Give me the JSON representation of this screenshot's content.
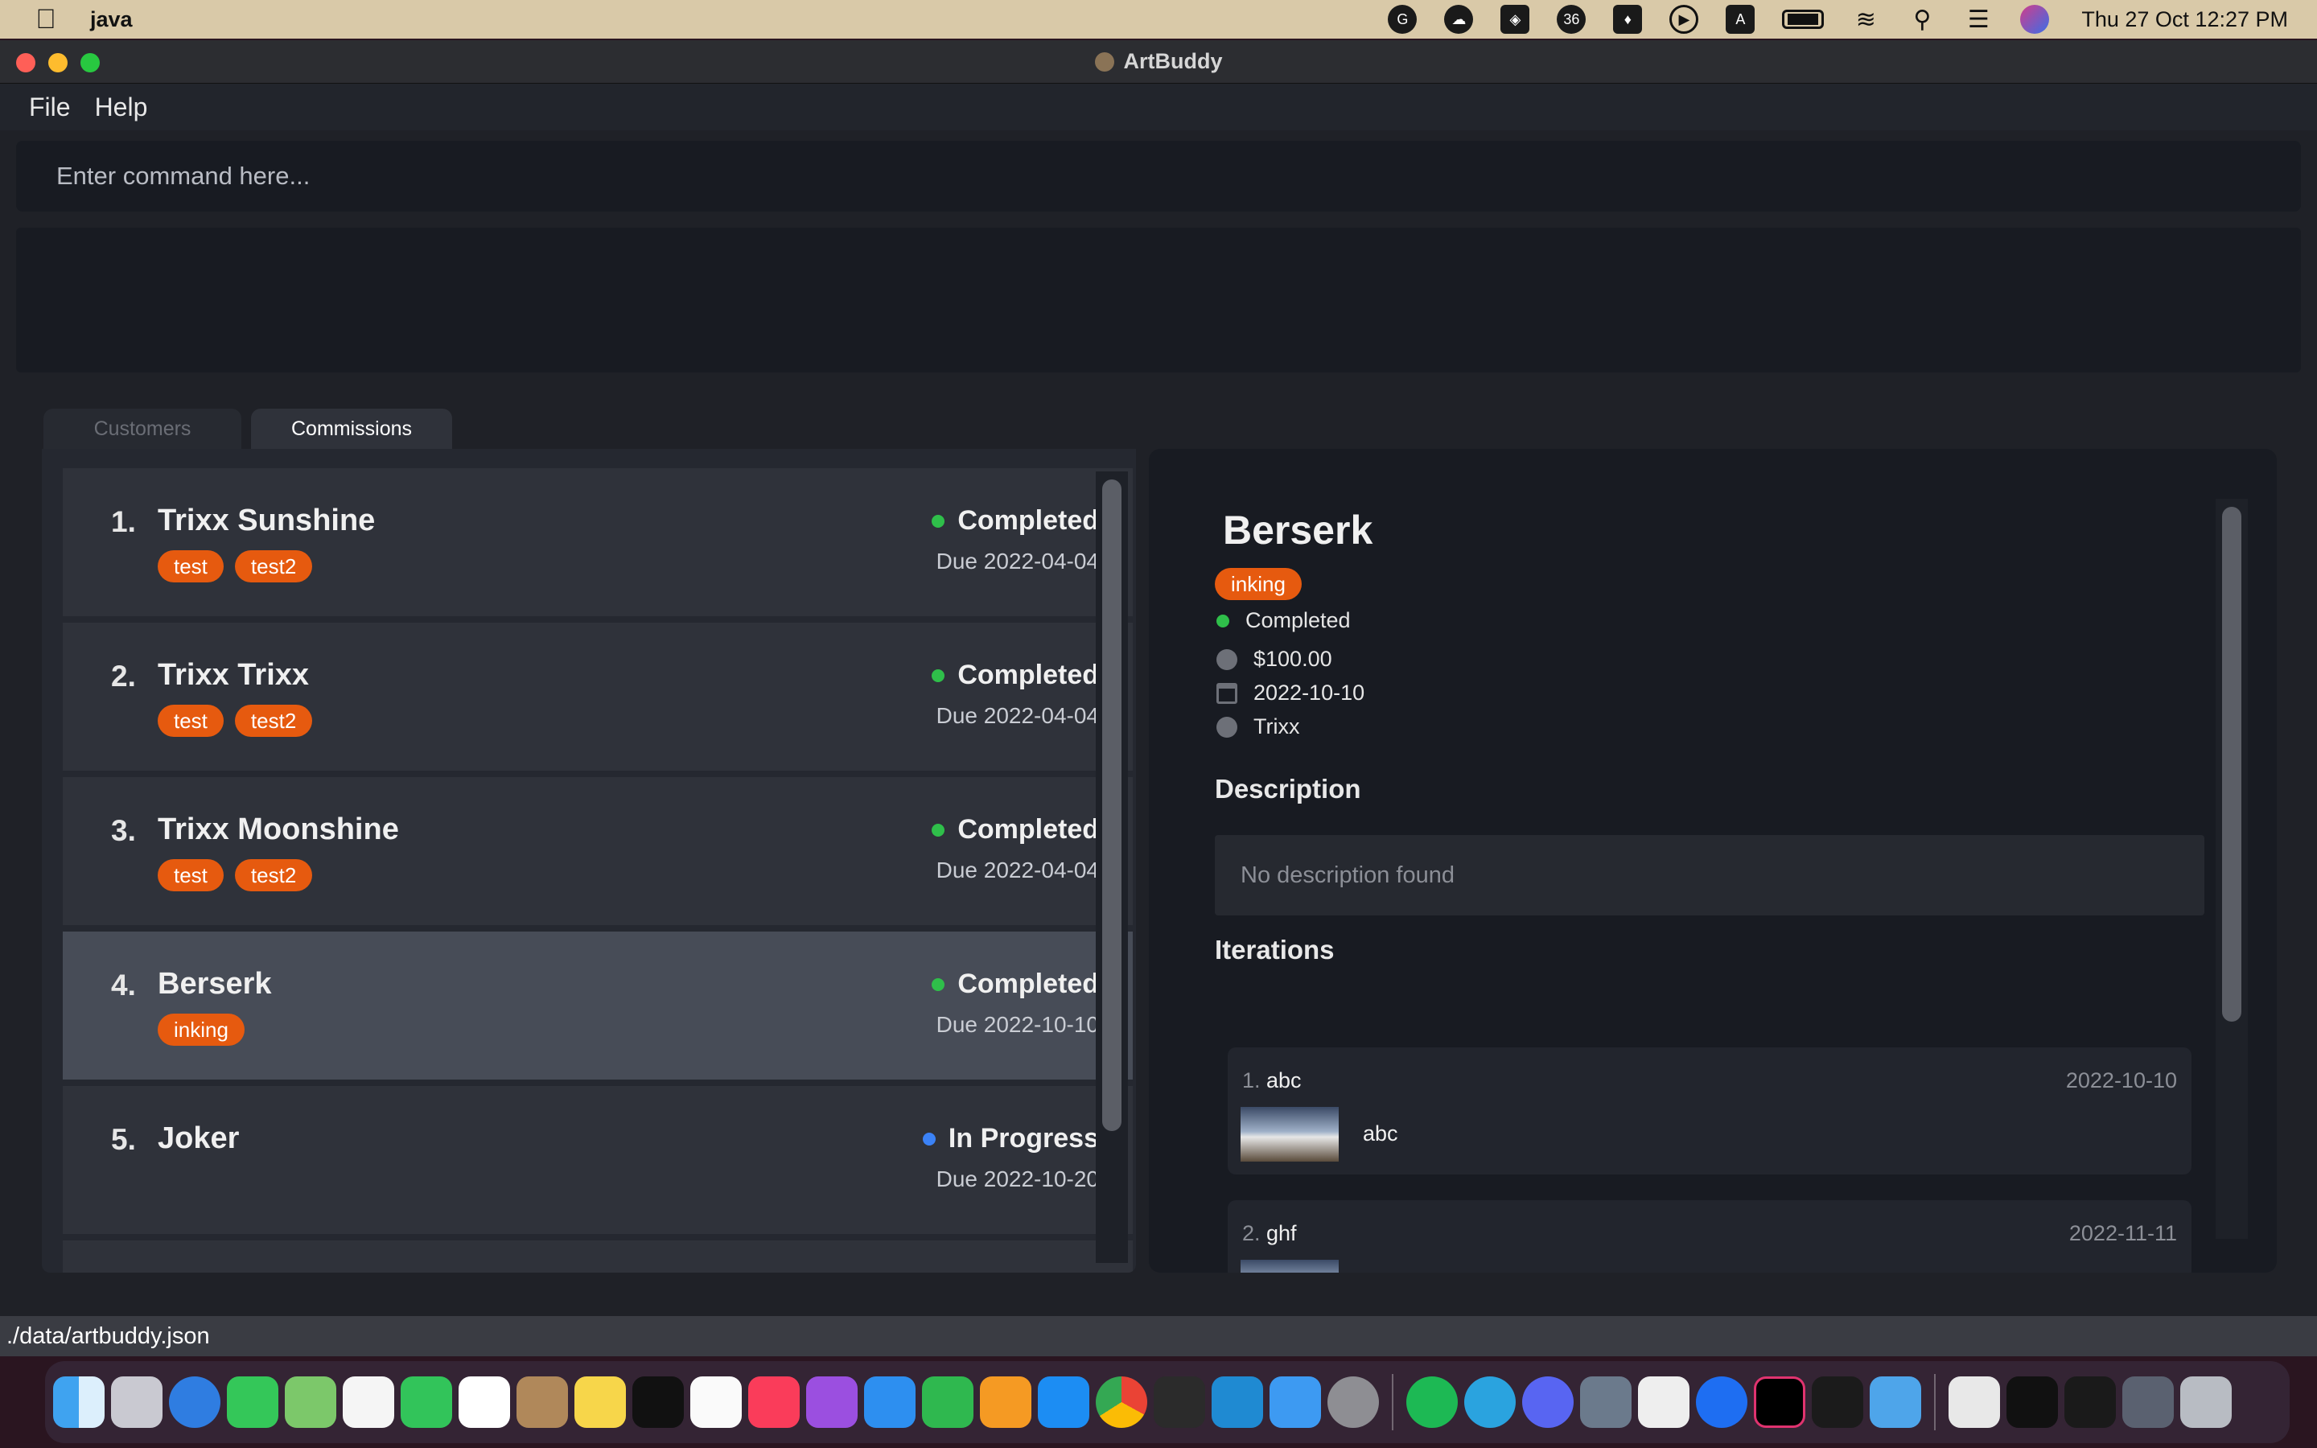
{
  "menubar": {
    "app_name": "java",
    "clock": "Thu 27 Oct  12:27 PM",
    "status_icons": [
      "grammarly-icon",
      "creative-cloud-icon",
      "unity-icon",
      "badge-36-icon",
      "evernote-icon",
      "play-icon",
      "keyboard-a-icon",
      "battery-icon",
      "wifi-icon",
      "spotlight-icon",
      "control-center-icon",
      "siri-icon"
    ],
    "badge_36": "36",
    "keyboard_letter": "A"
  },
  "window": {
    "title": "ArtBuddy",
    "menu": {
      "file": "File",
      "help": "Help"
    }
  },
  "command": {
    "placeholder": "Enter command here..."
  },
  "tabs": {
    "customers": "Customers",
    "commissions": "Commissions"
  },
  "commissions": [
    {
      "index": "1.",
      "name": "Trixx Sunshine",
      "tags": [
        "test",
        "test2"
      ],
      "status": "Completed",
      "due": "Due 2022-04-04"
    },
    {
      "index": "2.",
      "name": "Trixx Trixx",
      "tags": [
        "test",
        "test2"
      ],
      "status": "Completed",
      "due": "Due 2022-04-04"
    },
    {
      "index": "3.",
      "name": "Trixx Moonshine",
      "tags": [
        "test",
        "test2"
      ],
      "status": "Completed",
      "due": "Due 2022-04-04"
    },
    {
      "index": "4.",
      "name": "Berserk",
      "tags": [
        "inking"
      ],
      "status": "Completed",
      "due": "Due 2022-10-10"
    },
    {
      "index": "5.",
      "name": "Joker",
      "tags": [],
      "status": "In Progress",
      "due": "Due 2022-10-20"
    }
  ],
  "detail": {
    "title": "Berserk",
    "tag": "inking",
    "status": "Completed",
    "fee": "$100.00",
    "deadline": "2022-10-10",
    "customer": "Trixx",
    "description_heading": "Description",
    "description": "No description found",
    "iterations_heading": "Iterations",
    "iterations": [
      {
        "index": "1.",
        "title": "abc",
        "date": "2022-10-10",
        "caption": "abc"
      },
      {
        "index": "2.",
        "title": "ghf",
        "date": "2022-11-11",
        "caption": ""
      }
    ]
  },
  "status_bar": {
    "path": "./data/artbuddy.json"
  },
  "colors": {
    "tag": "#e65a0f",
    "completed": "#2fbf4a",
    "in_progress": "#3b82f6"
  }
}
